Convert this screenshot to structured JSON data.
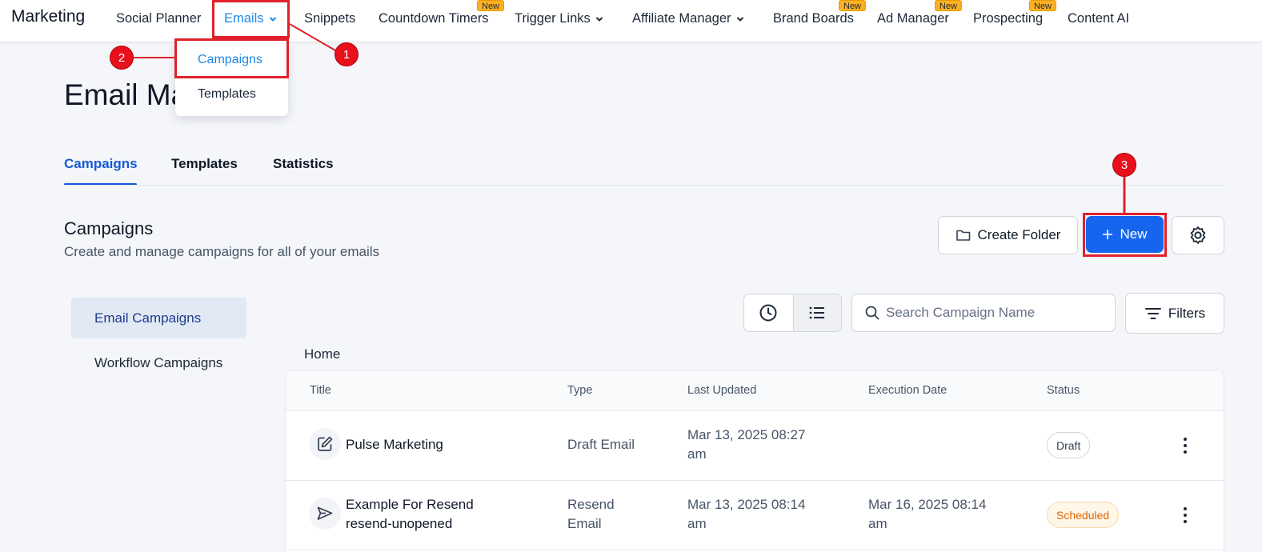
{
  "topnav": {
    "brand": "Marketing",
    "items": [
      {
        "label": "Social Planner"
      },
      {
        "label": "Emails"
      },
      {
        "label": "Snippets"
      },
      {
        "label": "Countdown Timers",
        "badge": "New"
      },
      {
        "label": "Trigger Links"
      },
      {
        "label": "Affiliate Manager"
      },
      {
        "label": "Brand Boards",
        "badge": "New"
      },
      {
        "label": "Ad Manager",
        "badge": "New"
      },
      {
        "label": "Prospecting",
        "badge": "New"
      },
      {
        "label": "Content AI"
      }
    ]
  },
  "dropdown": {
    "items": [
      {
        "label": "Campaigns"
      },
      {
        "label": "Templates"
      }
    ]
  },
  "page": {
    "title": "Email Ma"
  },
  "tabs": [
    {
      "label": "Campaigns"
    },
    {
      "label": "Templates"
    },
    {
      "label": "Statistics"
    }
  ],
  "section": {
    "title": "Campaigns",
    "subtitle": "Create and manage campaigns for all of your emails",
    "create_folder_label": "Create Folder",
    "new_label": "New"
  },
  "sidebar": {
    "items": [
      {
        "label": "Email Campaigns"
      },
      {
        "label": "Workflow Campaigns"
      }
    ]
  },
  "toolbar": {
    "search_placeholder": "Search Campaign Name",
    "filters_label": "Filters"
  },
  "breadcrumb": "Home",
  "table": {
    "headers": [
      "Title",
      "Type",
      "Last Updated",
      "Execution Date",
      "Status"
    ],
    "rows": [
      {
        "title": "Pulse Marketing",
        "type": "Draft Email",
        "last_updated_1": "Mar 13, 2025 08:27",
        "last_updated_2": "am",
        "status": "Draft",
        "icon": "edit-icon"
      },
      {
        "title_1": "Example For Resend",
        "title_2": "resend-unopened",
        "type_1": "Resend",
        "type_2": "Email",
        "last_updated_1": "Mar 13, 2025 08:14",
        "last_updated_2": "am",
        "execution_1": "Mar 16, 2025 08:14",
        "execution_2": "am",
        "status": "Scheduled",
        "icon": "send-icon"
      }
    ]
  },
  "annotations": [
    "1",
    "2",
    "3"
  ],
  "colors": {
    "accent": "#1565ef",
    "active_link": "#1e88e5",
    "annotation": "#e0212b",
    "badge": "#fdb022"
  }
}
